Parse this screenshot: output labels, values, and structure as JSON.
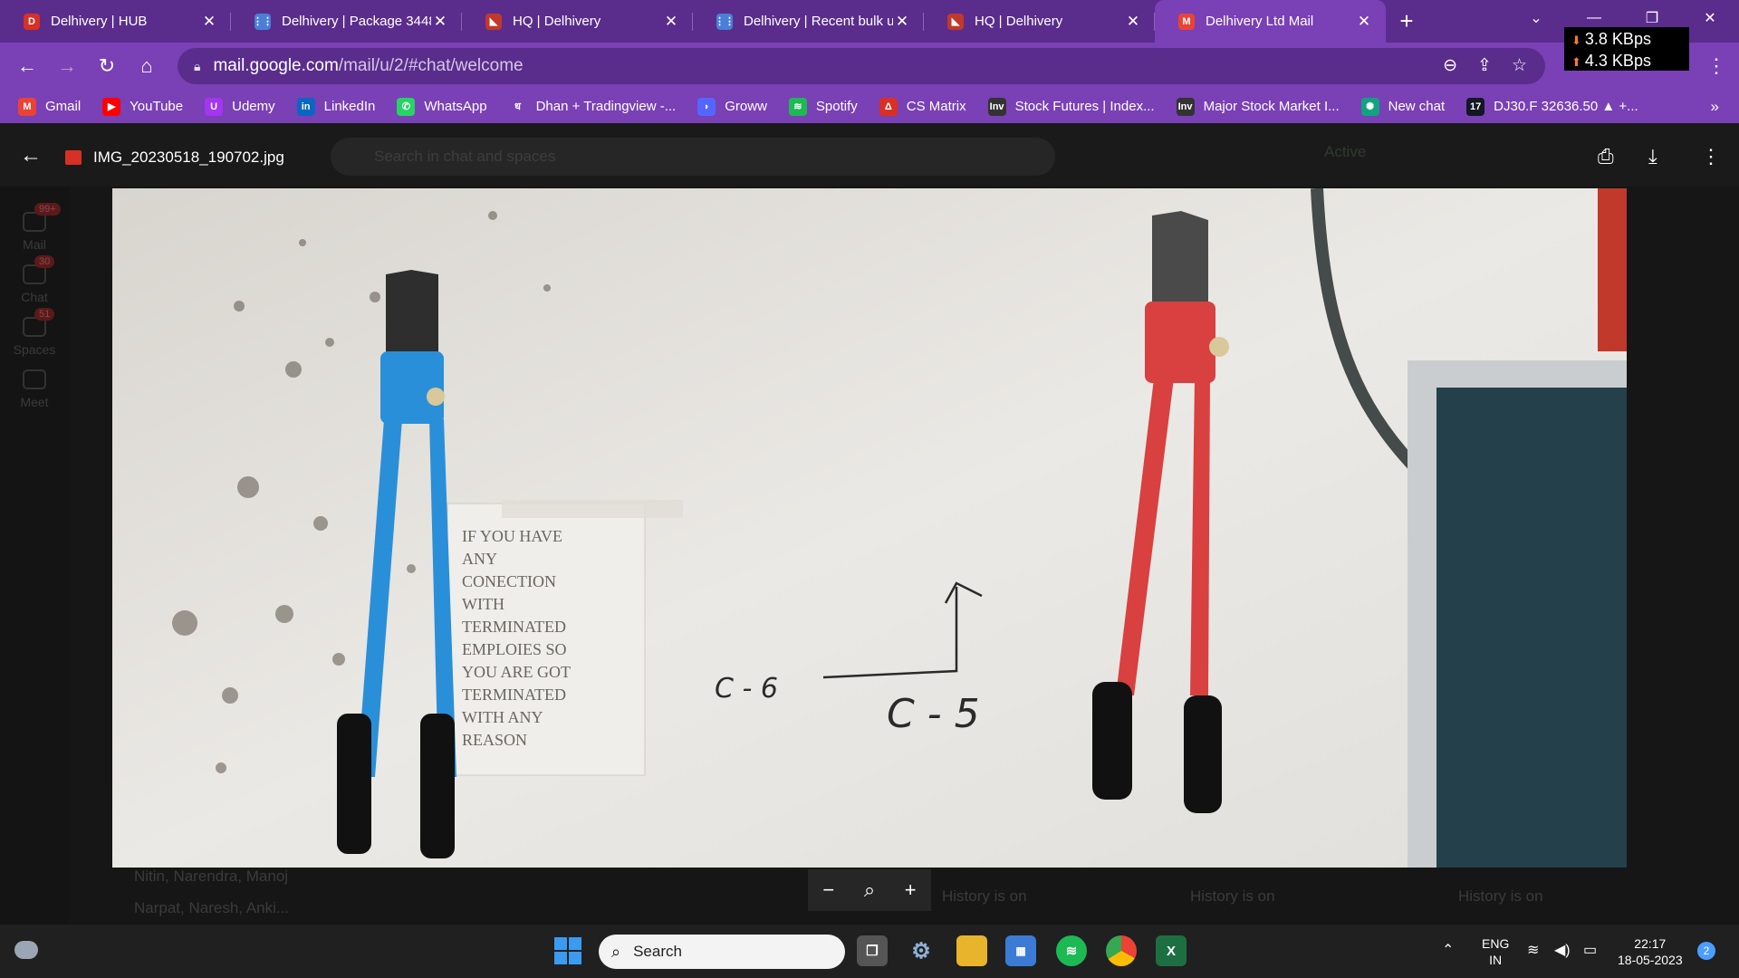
{
  "browser": {
    "tabs": [
      {
        "title": "Delhivery | HUB",
        "fav_color": "#d93025",
        "fav_glyph": "D"
      },
      {
        "title": "Delhivery | Package 3448",
        "fav_color": "#4a7fd6",
        "fav_glyph": "⋮⋮"
      },
      {
        "title": "HQ | Delhivery",
        "fav_color": "#c0392b",
        "fav_glyph": "◣"
      },
      {
        "title": "Delhivery | Recent bulk u",
        "fav_color": "#4a7fd6",
        "fav_glyph": "⋮⋮"
      },
      {
        "title": "HQ | Delhivery",
        "fav_color": "#c0392b",
        "fav_glyph": "◣"
      },
      {
        "title": "Delhivery Ltd Mail",
        "fav_color": "#ea4335",
        "fav_glyph": "M"
      }
    ],
    "active_tab_index": 5,
    "url_host": "mail.google.com",
    "url_path": "/mail/u/2/#chat/welcome",
    "network": {
      "down": "3.8 KBps",
      "up": "4.3 KBps"
    },
    "bookmarks": [
      {
        "label": "Gmail",
        "icon": "gmail-icon",
        "color": "#ea4335",
        "glyph": "M"
      },
      {
        "label": "YouTube",
        "icon": "youtube-icon",
        "color": "#ff0000",
        "glyph": "▶"
      },
      {
        "label": "Udemy",
        "icon": "udemy-icon",
        "color": "#a435f0",
        "glyph": "U"
      },
      {
        "label": "LinkedIn",
        "icon": "linkedin-icon",
        "color": "#0a66c2",
        "glyph": "in"
      },
      {
        "label": "WhatsApp",
        "icon": "whatsapp-icon",
        "color": "#25d366",
        "glyph": "✆"
      },
      {
        "label": "Dhan + Tradingview -...",
        "icon": "dhan-icon",
        "color": "#7a40b5",
        "glyph": "ध"
      },
      {
        "label": "Groww",
        "icon": "groww-icon",
        "color": "#5367ff",
        "glyph": "◗"
      },
      {
        "label": "Spotify",
        "icon": "spotify-icon",
        "color": "#1db954",
        "glyph": "≋"
      },
      {
        "label": "CS Matrix",
        "icon": "csmatrix-icon",
        "color": "#d93025",
        "glyph": "Δ"
      },
      {
        "label": "Stock Futures | Index...",
        "icon": "investing-icon",
        "color": "#333333",
        "glyph": "Inv"
      },
      {
        "label": "Major Stock Market I...",
        "icon": "investing-icon",
        "color": "#333333",
        "glyph": "Inv"
      },
      {
        "label": "New chat",
        "icon": "openai-icon",
        "color": "#10a37f",
        "glyph": "✺"
      },
      {
        "label": "DJ30.F 32636.50 ▲ +...",
        "icon": "tradingview-icon",
        "color": "#131722",
        "glyph": "17"
      }
    ]
  },
  "viewer": {
    "filename": "IMG_20230518_190702.jpg",
    "search_placeholder": "Search in chat and spaces",
    "status": "Active",
    "zoom": {
      "out": "−",
      "in": "+"
    }
  },
  "photo": {
    "sign_lines": [
      "IF YOU HAVE",
      "ANY",
      "CONECTION",
      "WITH",
      "TERMINATED",
      "EMPLOIES SO",
      "YOU ARE GOT",
      "TERMINATED",
      "WITH ANY",
      "REASON"
    ],
    "label_left": "C - 6",
    "label_right": "C - 5"
  },
  "background": {
    "rail": [
      {
        "label": "Mail",
        "badge": "99+"
      },
      {
        "label": "Chat",
        "badge": "30"
      },
      {
        "label": "Spaces",
        "badge": "51"
      },
      {
        "label": "Meet",
        "badge": ""
      }
    ],
    "chats": [
      "Nitin, Narendra, Manoj",
      "Narpat, Naresh, Anki..."
    ],
    "history": [
      "History is on",
      "History is on",
      "History is on"
    ]
  },
  "taskbar": {
    "search_label": "Search",
    "lang": "ENG",
    "region": "IN",
    "time": "22:17",
    "date": "18-05-2023",
    "notifications": "2"
  }
}
